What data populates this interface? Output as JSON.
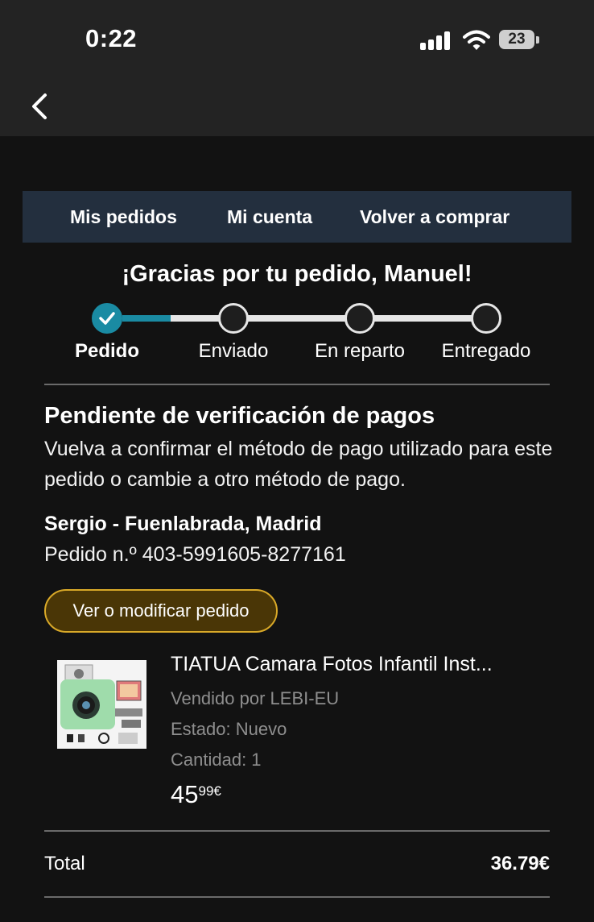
{
  "status_bar": {
    "time": "0:22",
    "battery": "23"
  },
  "nav": {
    "back_icon": "chevron-left-icon"
  },
  "top_nav": {
    "items": [
      "Mis pedidos",
      "Mi cuenta",
      "Volver a comprar"
    ]
  },
  "heading": "¡Gracias por tu pedido, Manuel!",
  "tracker": {
    "steps": [
      "Pedido",
      "Enviado",
      "En reparto",
      "Entregado"
    ],
    "current_step": 0,
    "accent_color": "#1a8ba3"
  },
  "status": {
    "title": "Pendiente de verificación de pagos",
    "description": "Vuelva a confirmar el método de pago utilizado para este pedido o cambie a otro método de pago."
  },
  "order": {
    "address": "Sergio - Fuenlabrada, Madrid",
    "number": "Pedido n.º 403-5991605-8277161",
    "modify_button": "Ver o modificar pedido"
  },
  "product": {
    "title": "TIATUA Camara Fotos Infantil Inst...",
    "seller": "Vendido por LEBI-EU",
    "condition": "Estado: Nuevo",
    "quantity": "Cantidad: 1",
    "price_int": "45",
    "price_dec": "99€"
  },
  "total": {
    "label": "Total",
    "value": "36.79€"
  }
}
